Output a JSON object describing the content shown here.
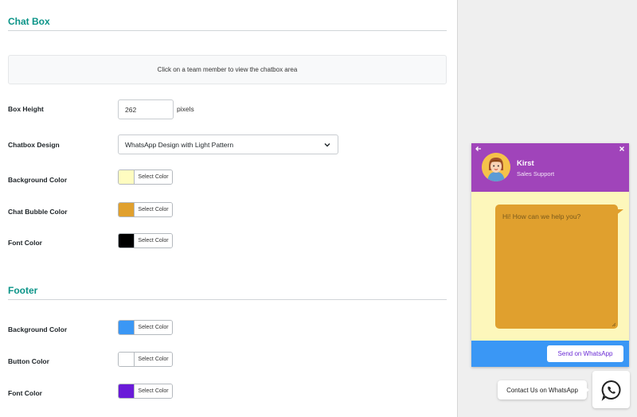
{
  "chat_box_section": {
    "title": "Chat Box",
    "notice": "Click on a team member to view the chatbox area",
    "box_height": {
      "label": "Box Height",
      "value": "262",
      "unit": "pixels"
    },
    "design": {
      "label": "Chatbox Design",
      "value": "WhatsApp Design with Light Pattern"
    },
    "background_color": {
      "label": "Background Color",
      "swatch": "#fffcc0",
      "button": "Select Color"
    },
    "bubble_color": {
      "label": "Chat Bubble Color",
      "swatch": "#e0a02e",
      "button": "Select Color"
    },
    "font_color": {
      "label": "Font Color",
      "swatch": "#000000",
      "button": "Select Color"
    }
  },
  "footer_section": {
    "title": "Footer",
    "background_color": {
      "label": "Background Color",
      "swatch": "#3a97f5",
      "button": "Select Color"
    },
    "button_color": {
      "label": "Button Color",
      "swatch": "#ffffff",
      "button": "Select Color"
    },
    "font_color": {
      "label": "Font Color",
      "swatch": "#6a1bd8",
      "button": "Select Color"
    }
  },
  "preview": {
    "agent_name": "Kirst",
    "agent_role": "Sales Support",
    "bubble_placeholder": "Hi! How can we help you?",
    "send_button": "Send on WhatsApp",
    "contact_label": "Contact Us on WhatsApp",
    "header_color": "#a044ba"
  }
}
